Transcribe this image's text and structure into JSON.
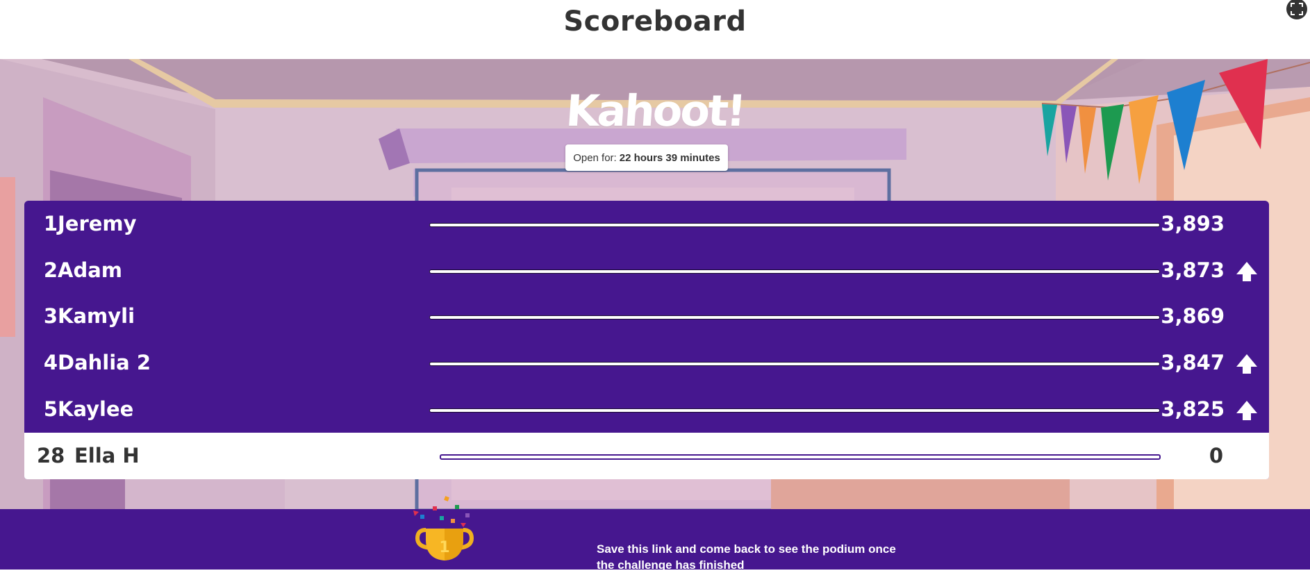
{
  "header": {
    "title": "Scoreboard",
    "fullscreen_icon": "fullscreen-icon"
  },
  "logo": {
    "text": "Kahoot!"
  },
  "status": {
    "open_label": "Open for:",
    "open_value": "22 hours 39 minutes"
  },
  "leaderboard": {
    "rows": [
      {
        "rank": "1",
        "name": "Jeremy",
        "score": "3,893",
        "trend": "none"
      },
      {
        "rank": "2",
        "name": "Adam",
        "score": "3,873",
        "trend": "up"
      },
      {
        "rank": "3",
        "name": "Kamyli",
        "score": "3,869",
        "trend": "none"
      },
      {
        "rank": "4",
        "name": "Dahlia 2",
        "score": "3,847",
        "trend": "up"
      },
      {
        "rank": "5",
        "name": "Kaylee",
        "score": "3,825",
        "trend": "up"
      }
    ],
    "current_player": {
      "rank": "28",
      "name": "Ella H",
      "score": "0"
    }
  },
  "footer": {
    "message": "Save this link and come back to see the podium once the challenge has finished",
    "trophy_icon": "trophy-icon",
    "trophy_number": "1"
  },
  "colors": {
    "brand_purple": "#46178f",
    "header_text": "#333333"
  }
}
